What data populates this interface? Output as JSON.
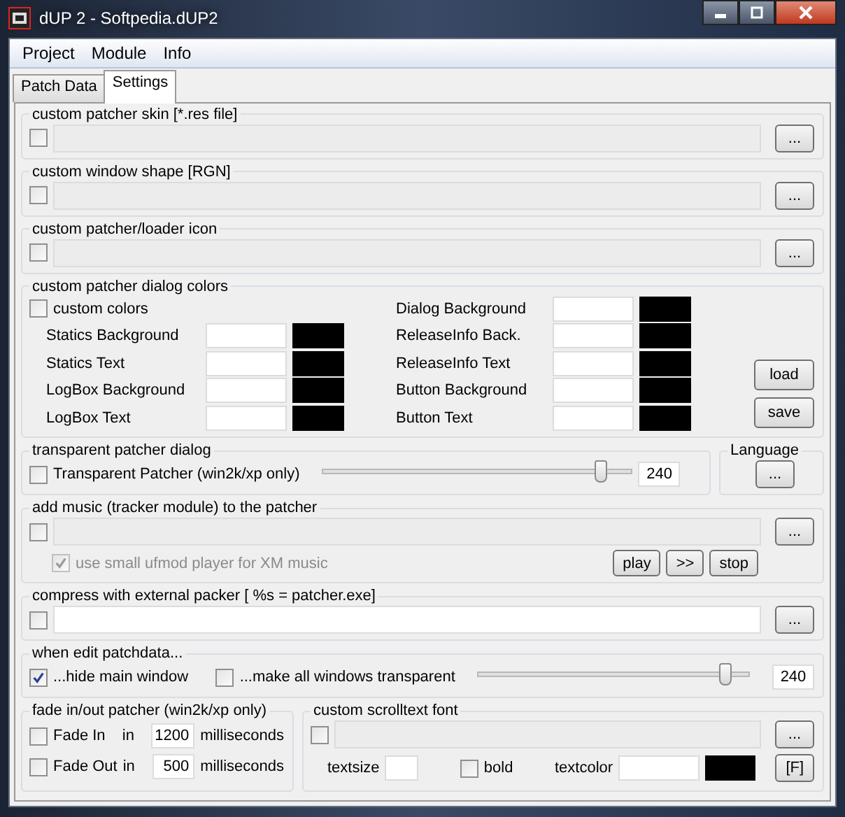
{
  "window": {
    "title": "dUP 2 - Softpedia.dUP2"
  },
  "menu": [
    "Project",
    "Module",
    "Info"
  ],
  "tabs": [
    {
      "label": "Patch Data",
      "selected": false
    },
    {
      "label": "Settings",
      "selected": true
    }
  ],
  "path_groups": [
    {
      "legend": "custom patcher skin [*.res file]",
      "checked": false,
      "disabled": true,
      "browse": "..."
    },
    {
      "legend": "custom window shape [RGN]",
      "checked": false,
      "disabled": true,
      "browse": "..."
    },
    {
      "legend": "custom patcher/loader icon",
      "checked": false,
      "disabled": true,
      "browse": "..."
    }
  ],
  "colors": {
    "legend": "custom patcher dialog colors",
    "custom": {
      "label": "custom colors",
      "checked": false
    },
    "left": [
      {
        "label": "Statics Background",
        "color": "#000000"
      },
      {
        "label": "Statics Text",
        "color": "#000000"
      },
      {
        "label": "LogBox Background",
        "color": "#000000"
      },
      {
        "label": "LogBox Text",
        "color": "#000000"
      }
    ],
    "right": [
      {
        "label": "Dialog Background",
        "color": "#000000"
      },
      {
        "label": "ReleaseInfo Back.",
        "color": "#000000"
      },
      {
        "label": "ReleaseInfo Text",
        "color": "#000000"
      },
      {
        "label": "Button Background",
        "color": "#000000"
      },
      {
        "label": "Button Text",
        "color": "#000000"
      }
    ],
    "load": "load",
    "save": "save"
  },
  "transparent": {
    "legend": "transparent patcher dialog",
    "label": "Transparent Patcher (win2k/xp only)",
    "checked": false,
    "level": 0.92,
    "value": "240"
  },
  "language": {
    "legend": "Language",
    "button": "..."
  },
  "music": {
    "legend": "add music (tracker module) to the patcher",
    "checked": false,
    "disabled": true,
    "browse": "...",
    "ufmod": {
      "label": "use small ufmod player for XM music",
      "checked": true,
      "disabled": true
    },
    "buttons": [
      "play",
      ">>",
      "stop"
    ]
  },
  "compress": {
    "legend": "compress with external packer [ %s = patcher.exe]",
    "checked": false,
    "disabled": false,
    "browse": "..."
  },
  "edit": {
    "legend": "when edit patchdata...",
    "hide": {
      "label": "...hide main window",
      "checked": true
    },
    "transparent": {
      "label": "...make all windows transparent",
      "checked": false
    },
    "level": 0.91,
    "value": "240"
  },
  "fade": {
    "legend": "fade in/out patcher (win2k/xp only)",
    "rows": [
      {
        "label": "Fade In",
        "in": "in",
        "value": "1200",
        "unit": "milliseconds",
        "checked": false
      },
      {
        "label": "Fade Out",
        "in": "in",
        "value": "500",
        "unit": "milliseconds",
        "checked": false
      }
    ]
  },
  "font": {
    "legend": "custom scrolltext font",
    "checked": false,
    "disabled": true,
    "browse": "...",
    "textsize": "textsize",
    "bold": {
      "label": "bold",
      "checked": false
    },
    "textcolor": "textcolor",
    "color": "#000000",
    "font_button": "[F]"
  }
}
